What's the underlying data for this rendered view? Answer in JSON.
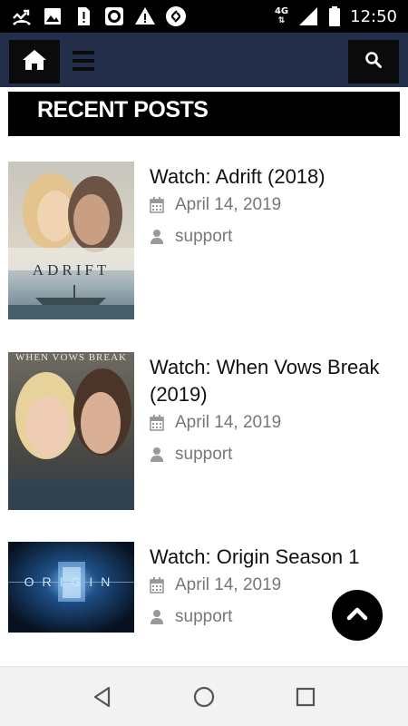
{
  "status_bar": {
    "time": "12:50",
    "network": "4G",
    "icons": [
      "missed-call-icon",
      "image-icon",
      "sim-alert-icon",
      "record-icon",
      "warning-icon",
      "shazam-icon",
      "signal-icon",
      "battery-icon"
    ]
  },
  "navbar": {
    "icons": [
      "home-icon",
      "menu-icon",
      "search-icon"
    ],
    "colors": {
      "bar": "#232f4a",
      "buttons": "#0b0b0b"
    }
  },
  "section": {
    "title": "RECENT POSTS"
  },
  "posts": [
    {
      "title": "Watch: Adrift (2018)",
      "date": "April 14, 2019",
      "author": "support",
      "poster_text": "ADRIFT"
    },
    {
      "title": "Watch: When Vows Break (2019)",
      "date": "April 14, 2019",
      "author": "support",
      "poster_text": "WHEN VOWS BREAK"
    },
    {
      "title": "Watch: Origin Season 1",
      "date": "April 14, 2019",
      "author": "support",
      "poster_text": "ORIGIN"
    }
  ],
  "android_nav": {
    "icons": [
      "back-icon",
      "home-circle-icon",
      "recents-icon"
    ]
  }
}
